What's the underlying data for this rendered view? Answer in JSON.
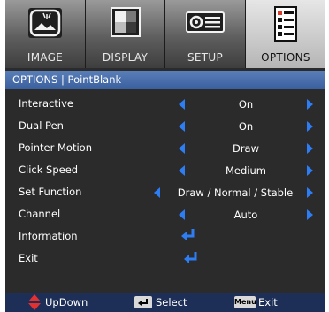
{
  "tabs": [
    {
      "label": "IMAGE",
      "icon": "image-icon",
      "active": false
    },
    {
      "label": "DISPLAY",
      "icon": "display-icon",
      "active": false
    },
    {
      "label": "SETUP",
      "icon": "projector-icon",
      "active": false
    },
    {
      "label": "OPTIONS",
      "icon": "checklist-icon",
      "active": true
    }
  ],
  "title": "OPTIONS | PointBlank",
  "items": [
    {
      "name": "Interactive",
      "value": "On"
    },
    {
      "name": "Dual Pen",
      "value": "On"
    },
    {
      "name": "Pointer Motion",
      "value": "Draw"
    },
    {
      "name": "Click Speed",
      "value": "Medium"
    },
    {
      "name": "Set Function",
      "value": "Draw / Normal / Stable"
    },
    {
      "name": "Channel",
      "value": "Auto"
    },
    {
      "name": "Information",
      "value": ""
    },
    {
      "name": "Exit",
      "value": ""
    }
  ],
  "footer": {
    "updown_label": "UpDown",
    "select_label": "Select",
    "menu_key": "Menu",
    "exit_label": "Exit"
  },
  "colors": {
    "accent": "#2d7df5",
    "title_bar": "#4a6fae",
    "footer": "#1e2f57",
    "background": "#2b2b2b"
  }
}
